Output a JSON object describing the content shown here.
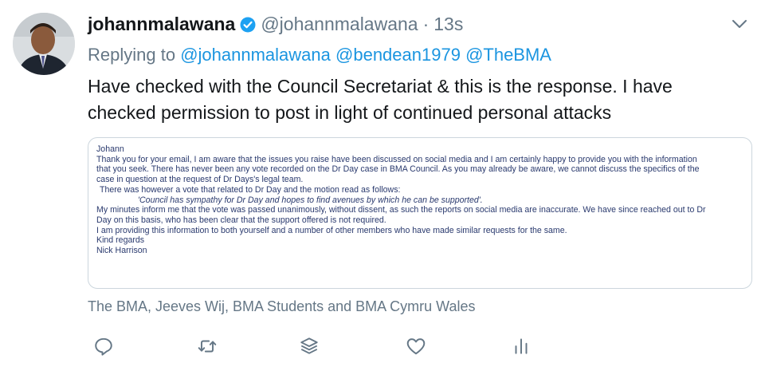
{
  "tweet": {
    "display_name": "johannmalawana",
    "handle": "@johannmalawana",
    "separator": "·",
    "time": "13s",
    "replying_prefix": "Replying to",
    "replying_to": [
      "@johannmalawana",
      "@bendean1979",
      "@TheBMA"
    ],
    "text_lines": [
      "Have checked with the Council Secretariat & this is the response. I have",
      "checked permission to post in light of continued personal attacks"
    ],
    "liked_by": "The BMA, Jeeves Wij, BMA Students and BMA Cymru Wales"
  },
  "letter": {
    "lines": [
      "Johann",
      "Thank you for your email, I am aware that the issues you raise have been discussed on social media and I am certainly happy to provide you with the information",
      "that you seek.  There has never been any vote recorded on the Dr Day case in BMA Council. As you may already be aware, we cannot discuss the specifics of the",
      "case in question at the request of Dr Days's legal team.",
      "There was however a vote that related to Dr Day and the motion read as follows:",
      "'Council has sympathy for Dr Day and hopes to find avenues by which he can be supported'.",
      "My minutes inform me that the vote was passed unanimously, without dissent, as such the reports on social media are inaccurate. We have since reached out to Dr",
      "Day on this basis, who has been clear that the support offered is not required.",
      "I am providing this information to both yourself and a number of other members who have made similar requests for the same.",
      "Kind regards",
      "Nick Harrison"
    ]
  },
  "icons": {
    "verified": "verified-badge-icon",
    "menu": "chevron-down-icon",
    "reply": "reply-icon",
    "retweet": "retweet-icon",
    "stack": "layers-icon",
    "like": "heart-icon",
    "analytics": "analytics-icon"
  },
  "colors": {
    "accent": "#1b95e0",
    "secondary_text": "#657786",
    "letter_text": "#2a3a6e"
  }
}
